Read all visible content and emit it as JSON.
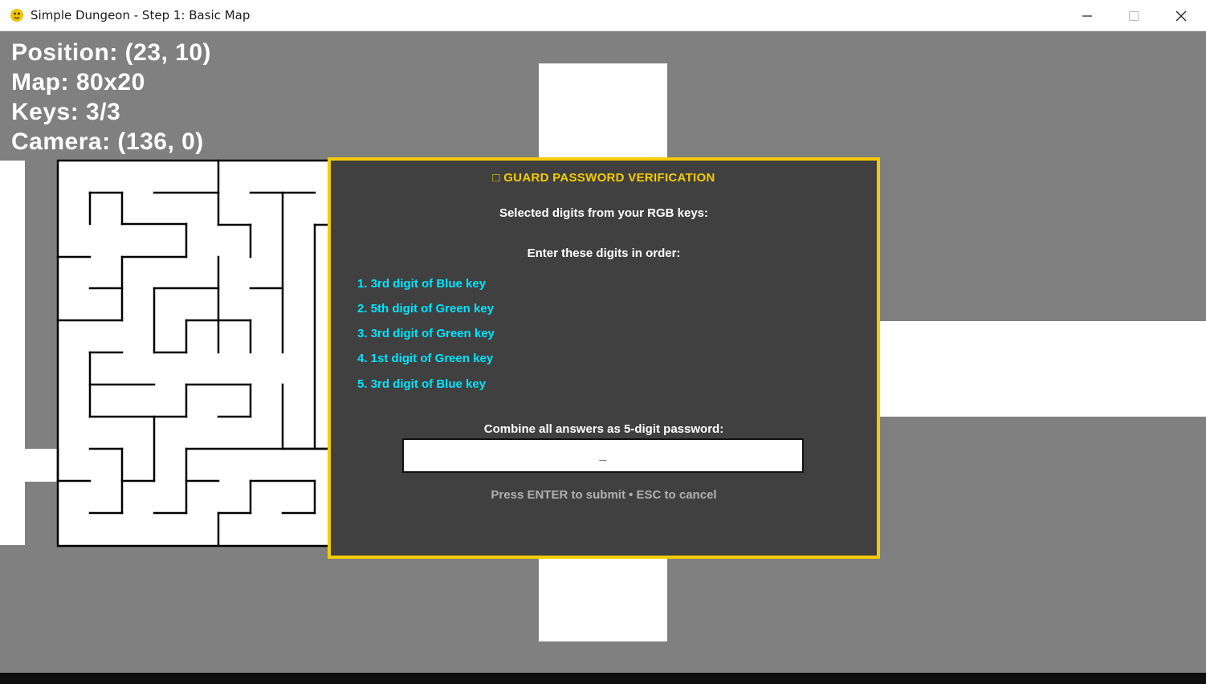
{
  "window": {
    "title": "Simple Dungeon - Step 1: Basic Map",
    "icon": "python-snake-icon",
    "controls": [
      "minimize",
      "maximize",
      "close"
    ]
  },
  "hud": {
    "position": "Position: (23, 10)",
    "map": "Map: 80x20",
    "keys": "Keys: 3/3",
    "camera": "Camera: (136, 0)"
  },
  "dialog": {
    "title": "□ GUARD PASSWORD VERIFICATION",
    "subtitle": "Selected digits from your RGB keys:",
    "instruction": "Enter these digits in order:",
    "items": [
      "1. 3rd digit of Blue key",
      "2. 5th digit of Green key",
      "3. 3rd digit of Green key",
      "4. 1st digit of Green key",
      "5. 3rd digit of Blue key"
    ],
    "combine_label": "Combine all answers as 5-digit password:",
    "input_value": "_",
    "hint": "Press ENTER to submit • ESC to cancel"
  },
  "colors": {
    "background": "#808080",
    "floor": "#ffffff",
    "dialog_bg": "#404040",
    "dialog_border": "#f5cc00",
    "title": "#f5cc00",
    "items": "#00e5ff",
    "hint": "#b0b0b0"
  }
}
